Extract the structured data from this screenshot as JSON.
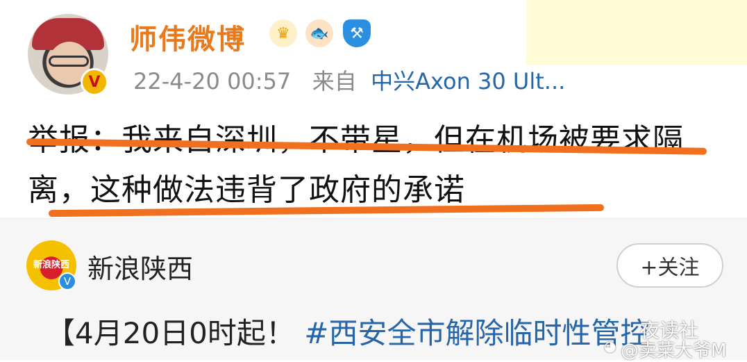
{
  "post": {
    "author": "师伟微博",
    "avatar_badge": "V",
    "badges": [
      "crown-icon",
      "fish-icon",
      "shield-hammer-icon"
    ],
    "time": "22-4-20 00:57",
    "from_label": "来自",
    "source": "中兴Axon 30 Ult...",
    "body": "举报：我来自深圳，不带星，但在机场被要求隔离，这种做法违背了政府的承诺",
    "underline_color": "#f07020"
  },
  "repost": {
    "account_name": "新浪陕西",
    "account_avatar_text": "新浪陕西",
    "verified_badge": "V",
    "follow_label": "+关注",
    "text_prefix": "【4月20日0时起！",
    "hashtag": "#西安全市解除临时性管控"
  },
  "watermark": {
    "line1": "夜读社",
    "line2": "@卖菜大爷M"
  },
  "colors": {
    "name": "#e87a1b",
    "link": "#2565a8",
    "meta": "#8a8a8a"
  }
}
